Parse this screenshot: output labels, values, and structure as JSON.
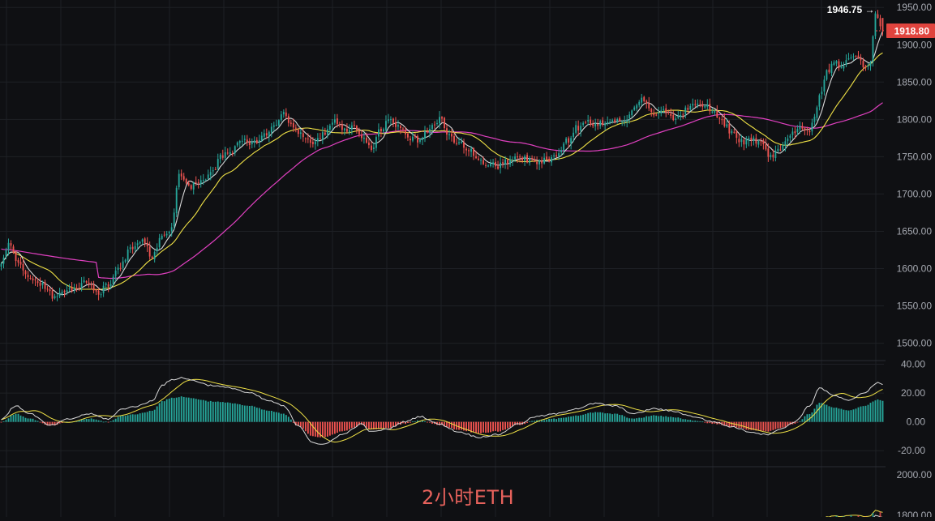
{
  "chart_data": {
    "type": "candlestick",
    "watermark": "2小时ETH",
    "colors": {
      "up": "#26a69a",
      "down": "#ef5350",
      "ma_fast": "#d9d9d9",
      "ma_mid": "#f0e246",
      "ma_slow": "#e040c0",
      "macd_dif": "#d9d9d9",
      "macd_dea": "#f0e246",
      "grid": "#1e2025",
      "label": "#a6a9b1",
      "background": "#0f1013"
    },
    "price_axis": {
      "ticks": [
        "1950.00",
        "1900.00",
        "1850.00",
        "1800.00",
        "1750.00",
        "1700.00",
        "1650.00",
        "1600.00",
        "1550.00",
        "1500.00"
      ],
      "ylim": [
        1480,
        1960
      ]
    },
    "high_marker": {
      "label": "1946.75 →",
      "value": 1946.75
    },
    "last_price": {
      "label": "1918.80",
      "value": 1918.8
    },
    "macd_axis": {
      "ticks": [
        "40.00",
        "20.00",
        "0.00",
        "-20.00"
      ],
      "ylim": [
        -30,
        42
      ]
    },
    "volume_axis": {
      "ticks": [
        "2000.00",
        "1800.00"
      ]
    },
    "anchors": [
      [
        0,
        1605
      ],
      [
        3,
        1630
      ],
      [
        7,
        1608
      ],
      [
        12,
        1586
      ],
      [
        17,
        1578
      ],
      [
        22,
        1560
      ],
      [
        26,
        1570
      ],
      [
        31,
        1574
      ],
      [
        35,
        1584
      ],
      [
        40,
        1568
      ],
      [
        44,
        1580
      ],
      [
        48,
        1600
      ],
      [
        53,
        1625
      ],
      [
        58,
        1635
      ],
      [
        62,
        1618
      ],
      [
        66,
        1640
      ],
      [
        70,
        1655
      ],
      [
        73,
        1730
      ],
      [
        77,
        1708
      ],
      [
        82,
        1716
      ],
      [
        87,
        1733
      ],
      [
        91,
        1752
      ],
      [
        95,
        1758
      ],
      [
        99,
        1775
      ],
      [
        103,
        1768
      ],
      [
        108,
        1778
      ],
      [
        112,
        1792
      ],
      [
        116,
        1806
      ],
      [
        120,
        1788
      ],
      [
        124,
        1778
      ],
      [
        128,
        1768
      ],
      [
        133,
        1780
      ],
      [
        137,
        1796
      ],
      [
        141,
        1784
      ],
      [
        145,
        1790
      ],
      [
        149,
        1772
      ],
      [
        152,
        1760
      ],
      [
        156,
        1788
      ],
      [
        160,
        1802
      ],
      [
        164,
        1786
      ],
      [
        168,
        1774
      ],
      [
        172,
        1772
      ],
      [
        176,
        1788
      ],
      [
        180,
        1800
      ],
      [
        184,
        1778
      ],
      [
        188,
        1768
      ],
      [
        192,
        1758
      ],
      [
        196,
        1748
      ],
      [
        200,
        1740
      ],
      [
        204,
        1738
      ],
      [
        208,
        1744
      ],
      [
        212,
        1750
      ],
      [
        216,
        1746
      ],
      [
        220,
        1742
      ],
      [
        224,
        1746
      ],
      [
        228,
        1750
      ],
      [
        232,
        1770
      ],
      [
        236,
        1788
      ],
      [
        240,
        1796
      ],
      [
        244,
        1794
      ],
      [
        248,
        1796
      ],
      [
        252,
        1800
      ],
      [
        256,
        1798
      ],
      [
        260,
        1814
      ],
      [
        264,
        1828
      ],
      [
        268,
        1808
      ],
      [
        272,
        1812
      ],
      [
        276,
        1802
      ],
      [
        280,
        1810
      ],
      [
        284,
        1822
      ],
      [
        288,
        1820
      ],
      [
        292,
        1812
      ],
      [
        296,
        1798
      ],
      [
        300,
        1782
      ],
      [
        304,
        1770
      ],
      [
        308,
        1774
      ],
      [
        312,
        1766
      ],
      [
        316,
        1750
      ],
      [
        320,
        1762
      ],
      [
        324,
        1778
      ],
      [
        328,
        1788
      ],
      [
        332,
        1786
      ],
      [
        334,
        1800
      ],
      [
        336,
        1830
      ],
      [
        339,
        1862
      ],
      [
        342,
        1876
      ],
      [
        345,
        1870
      ],
      [
        348,
        1880
      ],
      [
        351,
        1888
      ],
      [
        354,
        1872
      ],
      [
        357,
        1878
      ],
      [
        359,
        1942
      ],
      [
        362,
        1918.8
      ]
    ],
    "macd_anchors": [
      [
        0,
        0
      ],
      [
        6,
        10
      ],
      [
        12,
        4
      ],
      [
        20,
        -5
      ],
      [
        28,
        0
      ],
      [
        36,
        4
      ],
      [
        44,
        0
      ],
      [
        50,
        8
      ],
      [
        56,
        10
      ],
      [
        62,
        14
      ],
      [
        66,
        26
      ],
      [
        70,
        30
      ],
      [
        74,
        32
      ],
      [
        78,
        30
      ],
      [
        86,
        26
      ],
      [
        94,
        24
      ],
      [
        102,
        20
      ],
      [
        110,
        14
      ],
      [
        116,
        10
      ],
      [
        122,
        -5
      ],
      [
        128,
        -18
      ],
      [
        132,
        -20
      ],
      [
        140,
        -12
      ],
      [
        148,
        -4
      ],
      [
        152,
        -10
      ],
      [
        158,
        -8
      ],
      [
        166,
        -2
      ],
      [
        172,
        2
      ],
      [
        180,
        -4
      ],
      [
        188,
        -10
      ],
      [
        196,
        -14
      ],
      [
        204,
        -12
      ],
      [
        212,
        -4
      ],
      [
        220,
        2
      ],
      [
        228,
        4
      ],
      [
        236,
        8
      ],
      [
        244,
        12
      ],
      [
        252,
        10
      ],
      [
        260,
        4
      ],
      [
        268,
        8
      ],
      [
        276,
        6
      ],
      [
        284,
        2
      ],
      [
        292,
        -2
      ],
      [
        300,
        -6
      ],
      [
        308,
        -10
      ],
      [
        314,
        -12
      ],
      [
        320,
        -8
      ],
      [
        326,
        -2
      ],
      [
        332,
        10
      ],
      [
        336,
        24
      ],
      [
        342,
        18
      ],
      [
        348,
        14
      ],
      [
        354,
        20
      ],
      [
        360,
        28
      ],
      [
        362,
        26
      ]
    ]
  }
}
